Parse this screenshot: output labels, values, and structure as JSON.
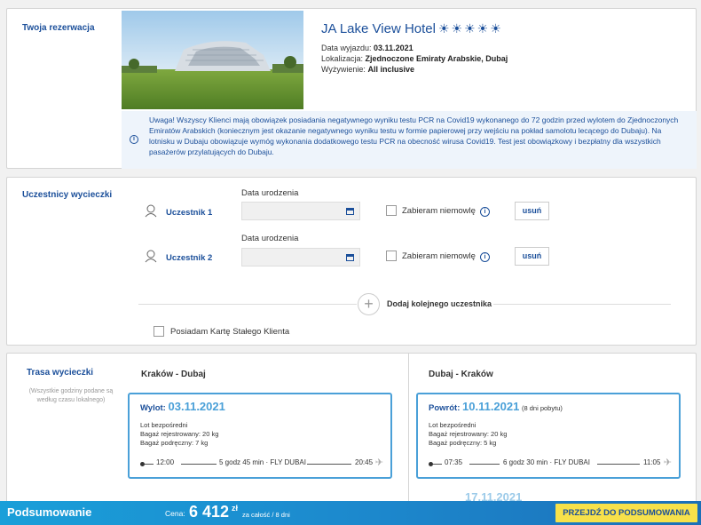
{
  "reservation": {
    "title": "Twoja rezerwacja",
    "hotel_name": "JA Lake View Hotel",
    "stars": "☀☀☀☀☀",
    "departure_label": "Data wyjazdu:",
    "departure_value": "03.11.2021",
    "location_label": "Lokalizacja:",
    "location_value": "Zjednoczone Emiraty Arabskie, Dubaj",
    "board_label": "Wyżywienie:",
    "board_value": "All inclusive",
    "notice_icon": "i",
    "notice": "Uwaga! Wszyscy Klienci mają obowiązek posiadania negatywnego wyniku testu PCR na Covid19 wykonanego do 72 godzin przed wylotem do Zjednoczonych Emiratów Arabskich (koniecznym jest okazanie negatywnego wyniku testu w formie papierowej przy wejściu na pokład samolotu lecącego do Dubaju). Na lotnisku w Dubaju obowiązuje wymóg wykonania dodatkowego testu PCR na obecność wirusa Covid19. Test jest obowiązkowy i bezpłatny dla wszystkich pasażerów przylatujących do Dubaju."
  },
  "participants": {
    "title": "Uczestnicy wycieczki",
    "items": [
      {
        "name": "Uczestnik 1",
        "dob_label": "Data urodzenia",
        "dob_value": "",
        "infant_label": "Zabieram niemowlę",
        "remove_label": "usuń"
      },
      {
        "name": "Uczestnik 2",
        "dob_label": "Data urodzenia",
        "dob_value": "",
        "infant_label": "Zabieram niemowlę",
        "remove_label": "usuń"
      }
    ],
    "info_icon": "i",
    "add_symbol": "+",
    "add_label": "Dodaj kolejnego uczestnika",
    "loyalty_label": "Posiadam Kartę Stałego Klienta"
  },
  "route": {
    "title": "Trasa wycieczki",
    "note": "(Wszystkie godziny podane są według czasu lokalnego)",
    "outbound": {
      "title": "Kraków - Dubaj",
      "head_label": "Wylot:",
      "date": "03.11.2021",
      "extra": "",
      "type": "Lot bezpośredni",
      "bag_checked": "Bagaż rejestrowany: 20 kg",
      "bag_hand": "Bagaż podręczny: 7 kg",
      "dep_time": "12:00",
      "duration": "5 godz 45 min · FLY DUBAI",
      "arr_time": "20:45"
    },
    "return": {
      "title": "Dubaj - Kraków",
      "head_label": "Powrót:",
      "date": "10.11.2021",
      "extra": "(8 dni pobytu)",
      "type": "Lot bezpośredni",
      "bag_checked": "Bagaż rejestrowany: 20 kg",
      "bag_hand": "Bagaż podręczny: 5 kg",
      "dep_time": "07:35",
      "duration": "6 godz 30 min · FLY DUBAI",
      "arr_time": "11:05"
    },
    "next_date_partial": "17.11.2021"
  },
  "summary": {
    "title": "Podsumowanie",
    "price_label": "Cena:",
    "price": "6 412",
    "currency": "zł",
    "price_note": "za całość / 8 dni",
    "button_label": "PRZEJDŹ DO PODSUMOWANIA"
  },
  "colors": {
    "brand_blue": "#1b4f9a",
    "accent_blue": "#4aa0d8",
    "cta_yellow": "#f7e14a"
  }
}
